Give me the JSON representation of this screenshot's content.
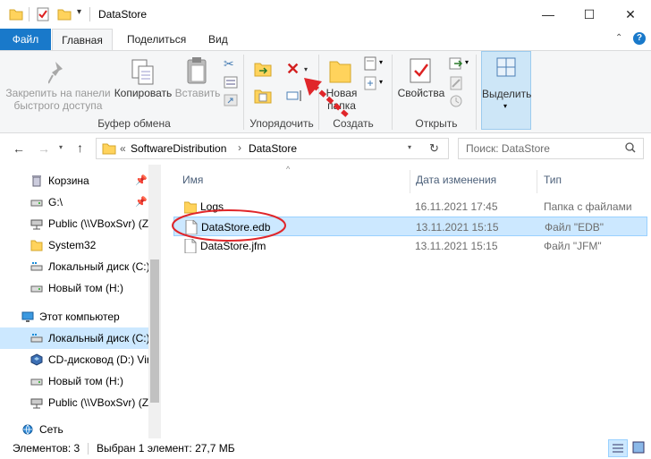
{
  "window": {
    "title": "DataStore",
    "controls": {
      "minimize": "—",
      "maximize": "☐",
      "close": "✕"
    }
  },
  "ribbon_tabs": {
    "file": "Файл",
    "home": "Главная",
    "share": "Поделиться",
    "view": "Вид"
  },
  "ribbon": {
    "pin_label": "Закрепить на панели быстрого доступа",
    "copy_label": "Копировать",
    "paste_label": "Вставить",
    "clipboard_group": "Буфер обмена",
    "organize_group": "Упорядочить",
    "new_folder_label": "Новая папка",
    "create_group": "Создать",
    "properties_label": "Свойства",
    "open_group": "Открыть",
    "select_label": "Выделить"
  },
  "address": {
    "prefix": "«",
    "path": [
      "SoftwareDistribution",
      "DataStore"
    ],
    "separator": "›"
  },
  "search": {
    "placeholder": "Поиск: DataStore"
  },
  "nav_items": [
    {
      "label": "Корзина",
      "icon": "recycle-bin-icon",
      "pinned": true
    },
    {
      "label": "G:\\",
      "icon": "drive-icon",
      "pinned": true
    },
    {
      "label": "Public (\\\\VBoxSvr) (Z",
      "icon": "network-drive-icon",
      "pinned": false
    },
    {
      "label": "System32",
      "icon": "folder-icon",
      "pinned": false
    },
    {
      "label": "Локальный диск (C:)",
      "icon": "local-disk-icon",
      "pinned": false
    },
    {
      "label": "Новый том (H:)",
      "icon": "drive-icon",
      "pinned": false
    },
    {
      "label": "Этот компьютер",
      "icon": "computer-icon",
      "pinned": false
    },
    {
      "label": "Локальный диск (C:)",
      "icon": "local-disk-icon",
      "pinned": false
    },
    {
      "label": "CD-дисковод (D:) Vir",
      "icon": "cd-drive-icon",
      "pinned": false
    },
    {
      "label": "Новый том (H:)",
      "icon": "drive-icon",
      "pinned": false
    },
    {
      "label": "Public (\\\\VBoxSvr) (Z",
      "icon": "network-drive-icon",
      "pinned": false
    },
    {
      "label": "Сеть",
      "icon": "network-icon",
      "pinned": false
    }
  ],
  "columns": {
    "name": "Имя",
    "date": "Дата изменения",
    "type": "Тип"
  },
  "files": [
    {
      "name": "Logs",
      "date": "16.11.2021 17:45",
      "type": "Папка с файлами",
      "icon": "folder-icon",
      "selected": false
    },
    {
      "name": "DataStore.edb",
      "date": "13.11.2021 15:15",
      "type": "Файл \"EDB\"",
      "icon": "file-icon",
      "selected": true
    },
    {
      "name": "DataStore.jfm",
      "date": "13.11.2021 15:15",
      "type": "Файл \"JFM\"",
      "icon": "file-icon",
      "selected": false
    }
  ],
  "status": {
    "items_count": "Элементов: 3",
    "selected_info": "Выбран 1 элемент: 27,7 МБ"
  },
  "colors": {
    "accent": "#1979ca",
    "selection": "#cce8ff",
    "annotation_red": "#e0262a",
    "folder": "#ffd35c"
  }
}
